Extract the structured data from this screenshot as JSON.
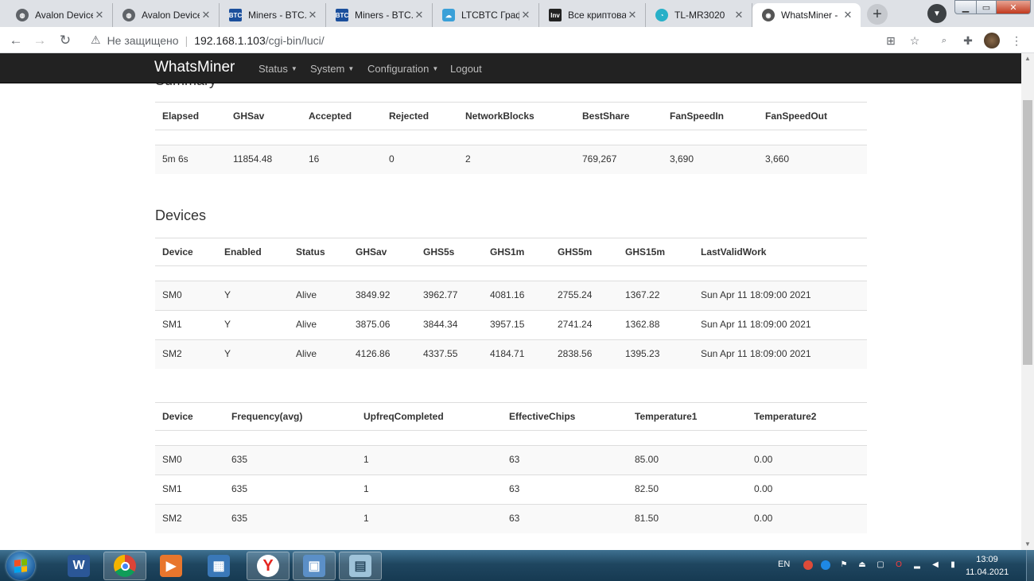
{
  "browser": {
    "tabs": [
      {
        "title": "Avalon Device",
        "icon": "globe-icon"
      },
      {
        "title": "Avalon Device",
        "icon": "globe-icon"
      },
      {
        "title": "Miners - BTC.c",
        "icon": "btc-icon"
      },
      {
        "title": "Miners - BTC.c",
        "icon": "btc-icon"
      },
      {
        "title": "LTCBTC Графи",
        "icon": "cloud-icon"
      },
      {
        "title": "Все криптова",
        "icon": "inv-icon"
      },
      {
        "title": "TL-MR3020",
        "icon": "tplink-icon"
      },
      {
        "title": "WhatsMiner -",
        "icon": "camera-icon"
      }
    ],
    "address": {
      "security_label": "Не защищено",
      "host": "192.168.1.103",
      "path": "/cgi-bin/luci/"
    }
  },
  "page": {
    "brand": "WhatsMiner",
    "menu": {
      "status": "Status",
      "system": "System",
      "configuration": "Configuration",
      "logout": "Logout"
    },
    "summary": {
      "title": "Summary",
      "headers": [
        "Elapsed",
        "GHSav",
        "Accepted",
        "Rejected",
        "NetworkBlocks",
        "BestShare",
        "FanSpeedIn",
        "FanSpeedOut"
      ],
      "rows": [
        [
          "5m 6s",
          "11854.48",
          "16",
          "0",
          "2",
          "769,267",
          "3,690",
          "3,660"
        ]
      ]
    },
    "devices": {
      "title": "Devices",
      "headers": [
        "Device",
        "Enabled",
        "Status",
        "GHSav",
        "GHS5s",
        "GHS1m",
        "GHS5m",
        "GHS15m",
        "LastValidWork"
      ],
      "rows": [
        [
          "SM0",
          "Y",
          "Alive",
          "3849.92",
          "3962.77",
          "4081.16",
          "2755.24",
          "1367.22",
          "Sun Apr 11 18:09:00 2021"
        ],
        [
          "SM1",
          "Y",
          "Alive",
          "3875.06",
          "3844.34",
          "3957.15",
          "2741.24",
          "1362.88",
          "Sun Apr 11 18:09:00 2021"
        ],
        [
          "SM2",
          "Y",
          "Alive",
          "4126.86",
          "4337.55",
          "4184.71",
          "2838.56",
          "1395.23",
          "Sun Apr 11 18:09:00 2021"
        ]
      ]
    },
    "device_stats": {
      "headers": [
        "Device",
        "Frequency(avg)",
        "UpfreqCompleted",
        "EffectiveChips",
        "Temperature1",
        "Temperature2"
      ],
      "rows": [
        [
          "SM0",
          "635",
          "1",
          "63",
          "85.00",
          "0.00"
        ],
        [
          "SM1",
          "635",
          "1",
          "63",
          "82.50",
          "0.00"
        ],
        [
          "SM2",
          "635",
          "1",
          "63",
          "81.50",
          "0.00"
        ]
      ]
    }
  },
  "taskbar": {
    "language": "EN",
    "time": "13:09",
    "date": "11.04.2021",
    "apps": [
      "word-icon",
      "chrome-icon",
      "media-player-icon",
      "network-app-icon",
      "yandex-browser-icon",
      "remote-desktop-icon",
      "notepad-icon"
    ]
  },
  "colors": {
    "navbar_bg": "#222222",
    "navbar_text": "#bdbdbd",
    "row_stripe": "#f9f9f9",
    "tabstrip_bg": "#dee1e6"
  }
}
